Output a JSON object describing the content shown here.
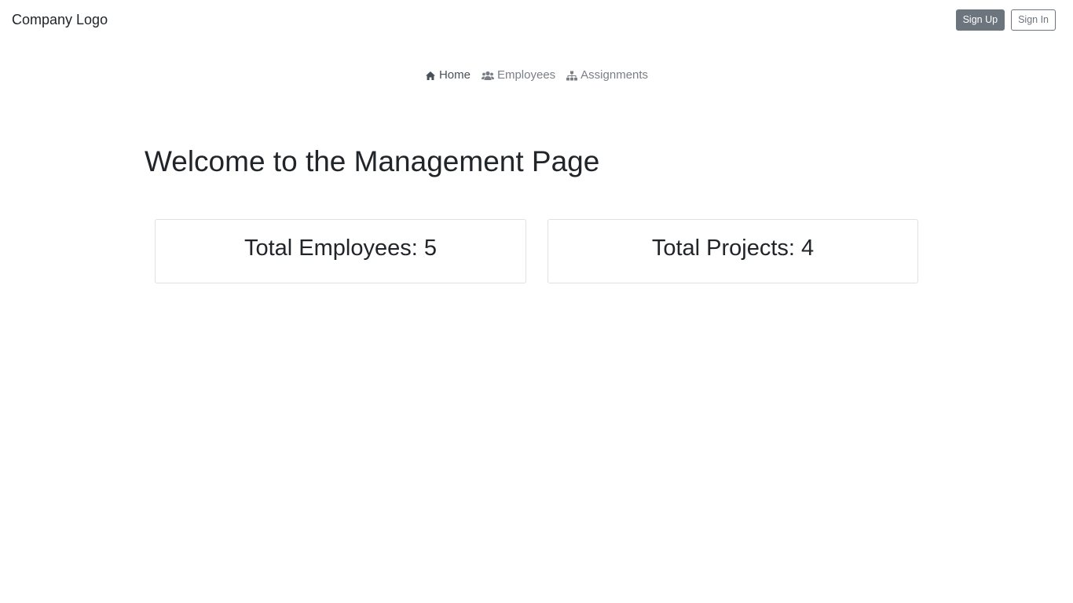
{
  "header": {
    "logo_text": "Company Logo",
    "signup_label": "Sign Up",
    "signin_label": "Sign In"
  },
  "nav": {
    "items": [
      {
        "label": "Home",
        "icon": "home-icon",
        "active": true
      },
      {
        "label": "Employees",
        "icon": "users-icon",
        "active": false
      },
      {
        "label": "Assignments",
        "icon": "sitemap-icon",
        "active": false
      }
    ]
  },
  "main": {
    "title": "Welcome to the Management Page",
    "stats": [
      {
        "label": "Total Employees: 5"
      },
      {
        "label": "Total Projects: 4"
      }
    ]
  },
  "colors": {
    "secondary": "#6c757d",
    "text": "#212529",
    "border": "#dee2e6"
  }
}
